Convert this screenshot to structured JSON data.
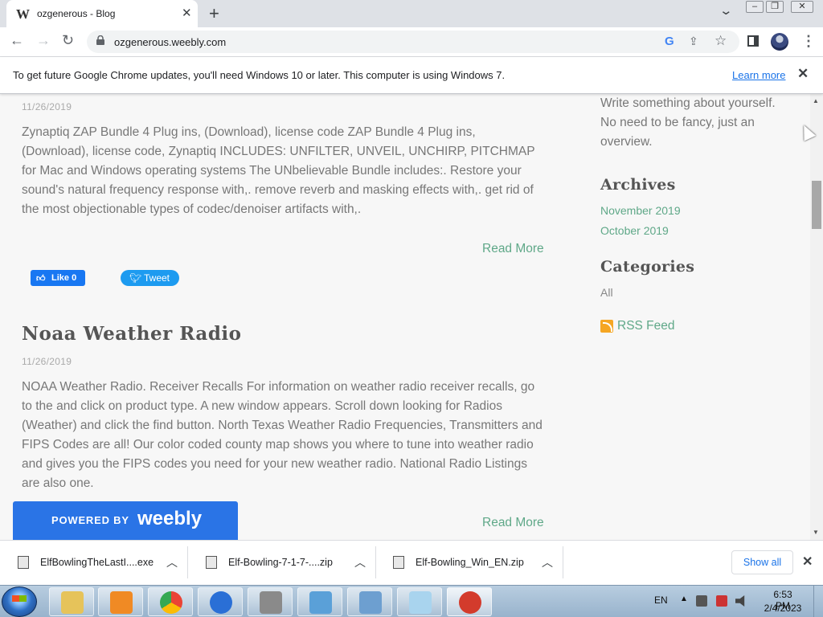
{
  "browser": {
    "tab_title": "ozgenerous - Blog",
    "tab_favicon": "W",
    "new_tab_glyph": "+",
    "url": "ozgenerous.weebly.com",
    "g_icon": "G",
    "icons": [
      "back-icon",
      "forward-icon",
      "reload-icon",
      "lock-icon",
      "google-icon",
      "share-icon",
      "star-icon",
      "side-panel-icon",
      "avatar",
      "menu-icon"
    ]
  },
  "infobar": {
    "message": "To get future Google Chrome updates, you'll need Windows 10 or later. This computer is using Windows 7.",
    "link": "Learn more"
  },
  "posts": [
    {
      "date": "11/26/2019",
      "body": "Zynaptiq ZAP Bundle 4 Plug ins, (Download), license code ZAP Bundle 4 Plug ins, (Download), license code, Zynaptiq INCLUDES: UNFILTER, UNVEIL, UNCHIRP, PITCHMAP for Mac and Windows operating systems The UNbelievable Bundle includes:. Restore your sound's natural frequency response with,. remove reverb and masking effects with,. get rid of the most objectionable types of codec/denoiser artifacts with,.",
      "read_more": "Read More"
    },
    {
      "title": "Noaa Weather Radio",
      "date": "11/26/2019",
      "body": "NOAA Weather Radio. Receiver Recalls For information on weather radio receiver recalls, go to the and click on product type. A new window appears. Scroll down looking for Radios (Weather) and click the find button. North Texas Weather Radio Frequencies, Transmitters and FIPS Codes are all! Our color coded county map shows you where to tune into weather radio and gives you the FIPS codes you need for your new weather radio. National Radio Listings are also one.",
      "read_more": "Read More"
    }
  ],
  "social": {
    "like_label": "Like 0",
    "tweet_label": "Tweet"
  },
  "sidebar": {
    "about": "Write something about yourself. No need to be fancy, just an overview.",
    "archives_heading": "Archives",
    "archives": [
      "November 2019",
      "October 2019"
    ],
    "categories_heading": "Categories",
    "categories": [
      "All"
    ],
    "rss": "RSS Feed"
  },
  "powered": {
    "by": "POWERED BY",
    "brand": "weebly"
  },
  "downloads": {
    "items": [
      {
        "name": "ElfBowlingTheLastI....exe"
      },
      {
        "name": "Elf-Bowling-7-1-7-....zip"
      },
      {
        "name": "Elf-Bowling_Win_EN.zip"
      }
    ],
    "show_all": "Show all"
  },
  "taskbar": {
    "language": "EN",
    "time": "6:53 PM",
    "date": "2/4/2023",
    "apps": [
      "explorer-icon",
      "media-player-icon",
      "chrome-icon",
      "help-icon",
      "film-icon",
      "photo-icon",
      "control-panel-icon",
      "notepad-icon",
      "elf-bowling-icon"
    ]
  },
  "colors": {
    "accent_link": "#5fa888",
    "weebly_blue": "#2a74e6",
    "chrome_blue": "#1a73e8"
  }
}
